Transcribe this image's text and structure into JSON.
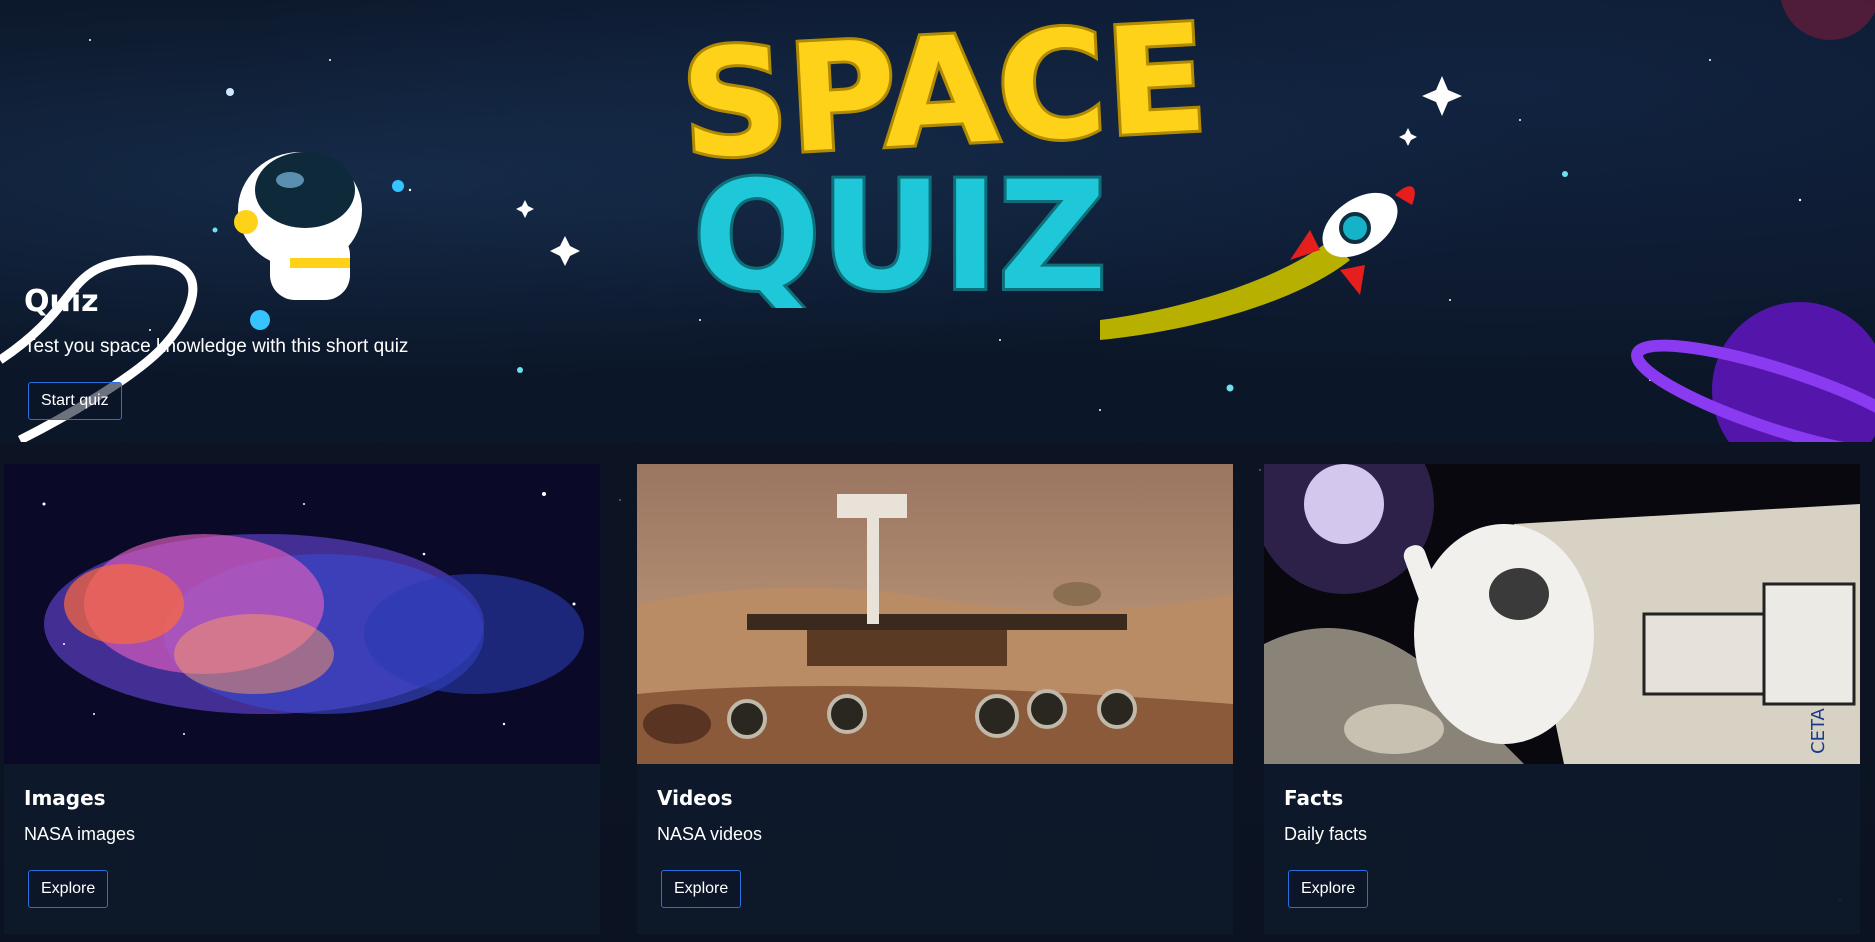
{
  "hero": {
    "logo_line1": "SPACE",
    "logo_line2": "QUIZ",
    "title": "Quiz",
    "subtitle": "Test you space knowledge with this short quiz",
    "button_label": "Start quiz"
  },
  "cards": [
    {
      "title": "Images",
      "subtitle": "NASA images",
      "button_label": "Explore"
    },
    {
      "title": "Videos",
      "subtitle": "NASA videos",
      "button_label": "Explore"
    },
    {
      "title": "Facts",
      "subtitle": "Daily facts",
      "button_label": "Explore"
    }
  ],
  "colors": {
    "background": "#0c1424",
    "button_border": "#2a6fe0",
    "logo_yellow": "#ffd21a",
    "logo_cyan": "#1ec8d8"
  },
  "icons": [
    "astronaut-illustration",
    "rocket-illustration",
    "planet-illustration"
  ]
}
